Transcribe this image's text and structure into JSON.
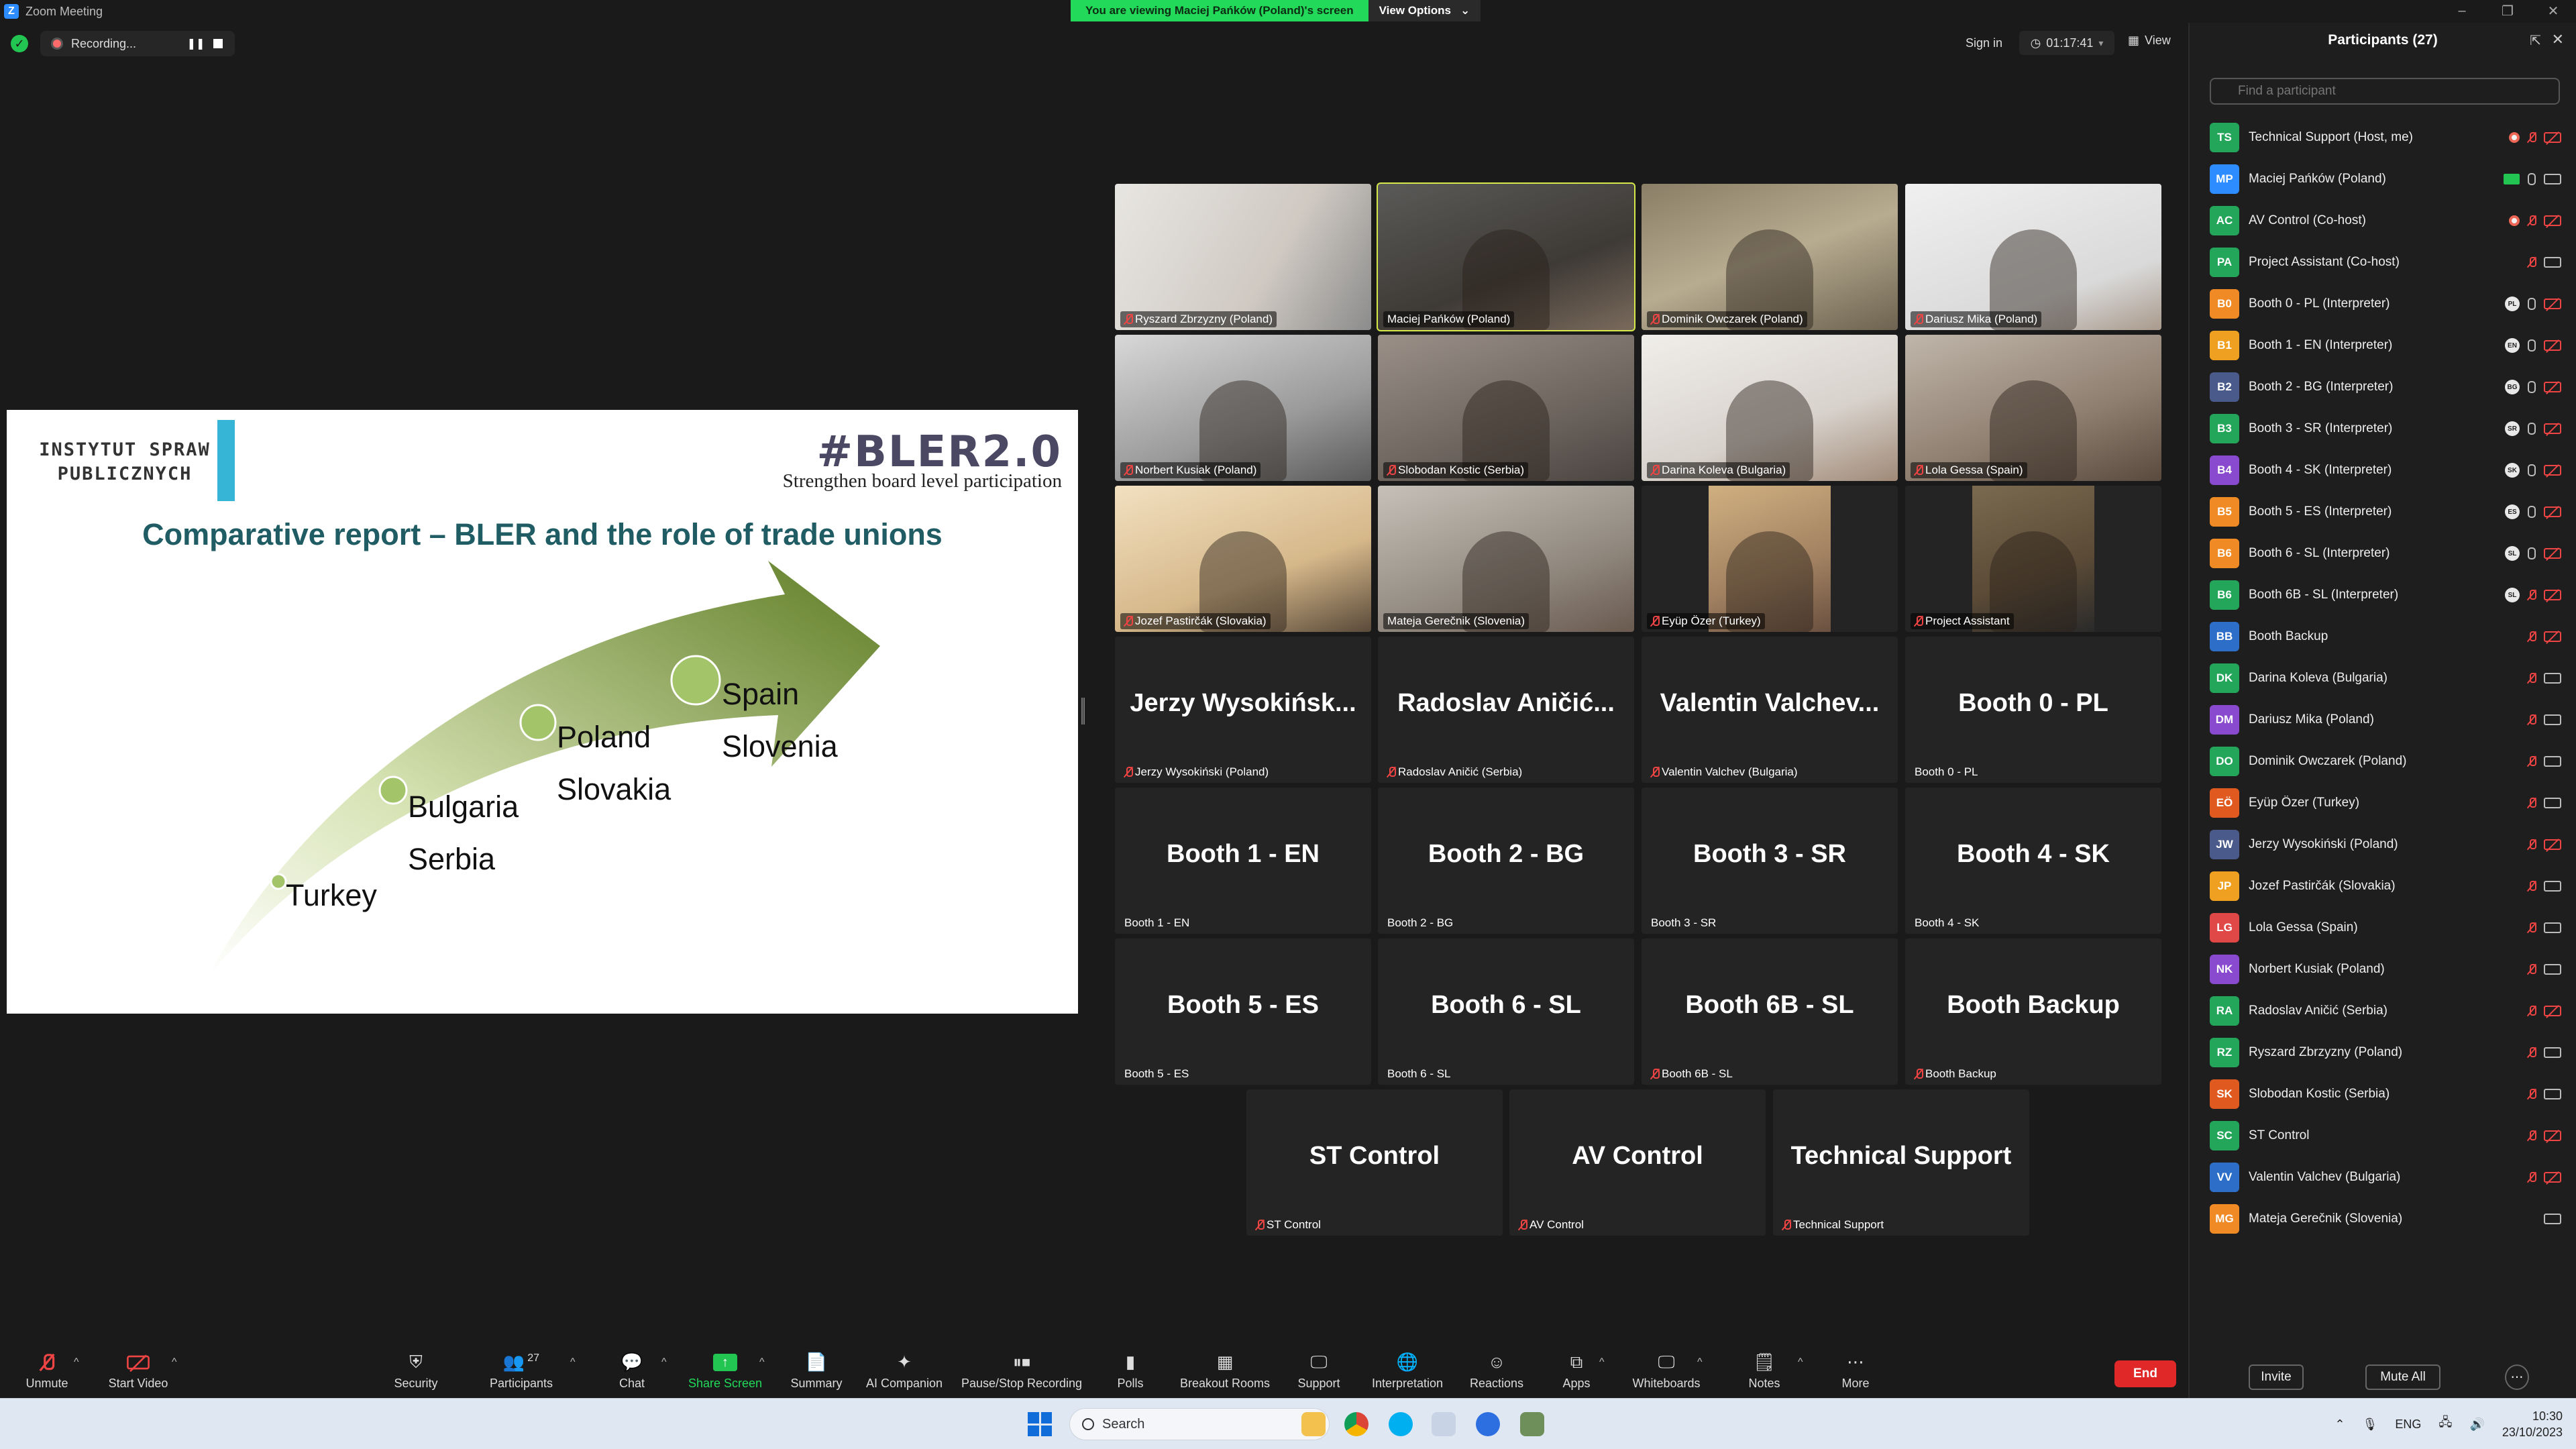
{
  "window": {
    "title": "Zoom Meeting"
  },
  "banner": {
    "viewing": "You are viewing Maciej Pańków (Poland)'s screen",
    "view_options": "View Options"
  },
  "topbar": {
    "recording": "Recording...",
    "sign_in": "Sign in",
    "timer": "01:17:41",
    "view": "View"
  },
  "slide": {
    "institute": "INSTYTUT SPRAW\nPUBLICZNYCH",
    "brand": "#BLER2.0",
    "tagline": "Strengthen board level participation",
    "title": "Comparative report – BLER and the role of trade unions",
    "countries": {
      "turkey": "Turkey",
      "bulgaria": "Bulgaria",
      "serbia": "Serbia",
      "poland": "Poland",
      "slovakia": "Slovakia",
      "spain": "Spain",
      "slovenia": "Slovenia"
    },
    "colors": {
      "arrow_dark": "#5f7d25",
      "arrow_light": "#e8efd2",
      "title": "#1f5c63",
      "accent_bar": "#36b5d6"
    }
  },
  "video_tiles": [
    {
      "name": "Ryszard Zbrzyzny (Poland)",
      "muted": true
    },
    {
      "name": "Maciej Pańków (Poland)",
      "muted": false,
      "speaking": true
    },
    {
      "name": "Dominik Owczarek (Poland)",
      "muted": true
    },
    {
      "name": "Dariusz Mika (Poland)",
      "muted": true
    },
    {
      "name": "Norbert Kusiak (Poland)",
      "muted": true
    },
    {
      "name": "Slobodan Kostic (Serbia)",
      "muted": true
    },
    {
      "name": "Darina Koleva (Bulgaria)",
      "muted": true
    },
    {
      "name": "Lola Gessa (Spain)",
      "muted": true
    },
    {
      "name": "Jozef Pastirčák (Slovakia)",
      "muted": true
    },
    {
      "name": "Mateja Gerečnik (Slovenia)",
      "muted": false
    },
    {
      "name": "Eyüp Özer (Turkey)",
      "muted": true
    },
    {
      "name": "Project Assistant",
      "muted": true
    }
  ],
  "name_tiles": [
    {
      "big": "Jerzy  Wysokińsk...",
      "name": "Jerzy Wysokiński (Poland)",
      "muted": true
    },
    {
      "big": "Radoslav  Aničić...",
      "name": "Radoslav Aničić (Serbia)",
      "muted": true
    },
    {
      "big": "Valentin  Valchev...",
      "name": "Valentin Valchev (Bulgaria)",
      "muted": true
    },
    {
      "big": "Booth 0 - PL",
      "name": "Booth 0 - PL",
      "muted": false
    },
    {
      "big": "Booth 1 - EN",
      "name": "Booth 1 - EN",
      "muted": false
    },
    {
      "big": "Booth 2 - BG",
      "name": "Booth 2 - BG",
      "muted": false
    },
    {
      "big": "Booth 3 - SR",
      "name": "Booth 3 - SR",
      "muted": false
    },
    {
      "big": "Booth 4 - SK",
      "name": "Booth 4 - SK",
      "muted": false
    },
    {
      "big": "Booth 5 - ES",
      "name": "Booth 5 - ES",
      "muted": false
    },
    {
      "big": "Booth 6 - SL",
      "name": "Booth 6 - SL",
      "muted": false
    },
    {
      "big": "Booth 6B - SL",
      "name": "Booth 6B - SL",
      "muted": true
    },
    {
      "big": "Booth Backup",
      "name": "Booth Backup",
      "muted": true
    },
    {
      "big": "ST Control",
      "name": "ST Control",
      "muted": true
    },
    {
      "big": "AV Control",
      "name": "AV Control",
      "muted": true
    },
    {
      "big": "Technical Support",
      "name": "Technical Support",
      "muted": true
    }
  ],
  "participants": {
    "header": "Participants (27)",
    "search_placeholder": "Find a participant",
    "invite": "Invite",
    "mute_all": "Mute All",
    "list": [
      {
        "initials": "TS",
        "color": "#23a55a",
        "name": "Technical Support (Host, me)",
        "rec": true,
        "mic": "off",
        "cam": "off"
      },
      {
        "initials": "MP",
        "color": "#2d8cff",
        "name": "Maciej Pańków (Poland)",
        "share": true,
        "mic": "on",
        "cam": "on"
      },
      {
        "initials": "AC",
        "color": "#23a55a",
        "name": "AV Control (Co-host)",
        "rec": true,
        "mic": "off",
        "cam": "off"
      },
      {
        "initials": "PA",
        "color": "#23a55a",
        "name": "Project Assistant (Co-host)",
        "mic": "off",
        "cam": "on"
      },
      {
        "initials": "B0",
        "color": "#f08a24",
        "name": "Booth 0 - PL (Interpreter)",
        "lang": "PL",
        "mic": "on",
        "cam": "off"
      },
      {
        "initials": "B1",
        "color": "#f0a020",
        "name": "Booth 1 - EN (Interpreter)",
        "lang": "EN",
        "mic": "on",
        "cam": "off"
      },
      {
        "initials": "B2",
        "color": "#4a5a8a",
        "name": "Booth 2 - BG (Interpreter)",
        "lang": "BG",
        "mic": "on",
        "cam": "off"
      },
      {
        "initials": "B3",
        "color": "#23a55a",
        "name": "Booth 3 - SR (Interpreter)",
        "lang": "SR",
        "mic": "on",
        "cam": "off"
      },
      {
        "initials": "B4",
        "color": "#8a4ad0",
        "name": "Booth 4 - SK (Interpreter)",
        "lang": "SK",
        "mic": "on",
        "cam": "off"
      },
      {
        "initials": "B5",
        "color": "#f08a24",
        "name": "Booth 5 - ES (Interpreter)",
        "lang": "ES",
        "mic": "on",
        "cam": "off"
      },
      {
        "initials": "B6",
        "color": "#f08a24",
        "name": "Booth 6 - SL (Interpreter)",
        "lang": "SL",
        "mic": "on",
        "cam": "off"
      },
      {
        "initials": "B6",
        "color": "#23a55a",
        "name": "Booth 6B - SL (Interpreter)",
        "lang": "SL",
        "mic": "off",
        "cam": "off"
      },
      {
        "initials": "BB",
        "color": "#2d6fc8",
        "name": "Booth Backup",
        "mic": "off",
        "cam": "off"
      },
      {
        "initials": "DK",
        "color": "#23a55a",
        "name": "Darina Koleva (Bulgaria)",
        "mic": "off",
        "cam": "on"
      },
      {
        "initials": "DM",
        "color": "#8a4ad0",
        "name": "Dariusz Mika (Poland)",
        "mic": "off",
        "cam": "on"
      },
      {
        "initials": "DO",
        "color": "#23a55a",
        "name": "Dominik Owczarek (Poland)",
        "mic": "off",
        "cam": "on"
      },
      {
        "initials": "EÖ",
        "color": "#e05a20",
        "name": "Eyüp Özer (Turkey)",
        "mic": "off",
        "cam": "on"
      },
      {
        "initials": "JW",
        "color": "#4a5a8a",
        "name": "Jerzy Wysokiński (Poland)",
        "mic": "off",
        "cam": "off"
      },
      {
        "initials": "JP",
        "color": "#f0a020",
        "name": "Jozef Pastirčák (Slovakia)",
        "mic": "off",
        "cam": "on"
      },
      {
        "initials": "LG",
        "color": "#e04848",
        "name": "Lola Gessa (Spain)",
        "mic": "off",
        "cam": "on"
      },
      {
        "initials": "NK",
        "color": "#8a4ad0",
        "name": "Norbert Kusiak (Poland)",
        "mic": "off",
        "cam": "on"
      },
      {
        "initials": "RA",
        "color": "#23a55a",
        "name": "Radoslav Aničić (Serbia)",
        "mic": "off",
        "cam": "off"
      },
      {
        "initials": "RZ",
        "color": "#23a55a",
        "name": "Ryszard Zbrzyzny (Poland)",
        "mic": "off",
        "cam": "on"
      },
      {
        "initials": "SK",
        "color": "#e05a20",
        "name": "Slobodan Kostic (Serbia)",
        "mic": "off",
        "cam": "on"
      },
      {
        "initials": "SC",
        "color": "#23a55a",
        "name": "ST Control",
        "mic": "off",
        "cam": "off"
      },
      {
        "initials": "VV",
        "color": "#2d6fc8",
        "name": "Valentin Valchev (Bulgaria)",
        "mic": "off",
        "cam": "off"
      },
      {
        "initials": "MG",
        "color": "#f08a24",
        "name": "Mateja Gerečnik (Slovenia)",
        "mic": "none",
        "cam": "on"
      }
    ]
  },
  "controls": {
    "unmute": "Unmute",
    "start_video": "Start Video",
    "security": "Security",
    "participants": "Participants",
    "participants_count": "27",
    "chat": "Chat",
    "share_screen": "Share Screen",
    "summary": "Summary",
    "ai_companion": "AI Companion",
    "pause_stop_recording": "Pause/Stop Recording",
    "polls": "Polls",
    "breakout_rooms": "Breakout Rooms",
    "support": "Support",
    "interpretation": "Interpretation",
    "reactions": "Reactions",
    "apps": "Apps",
    "whiteboards": "Whiteboards",
    "notes": "Notes",
    "more": "More",
    "end": "End"
  },
  "taskbar": {
    "search": "Search",
    "lang": "ENG",
    "time": "10:30",
    "date": "23/10/2023"
  }
}
